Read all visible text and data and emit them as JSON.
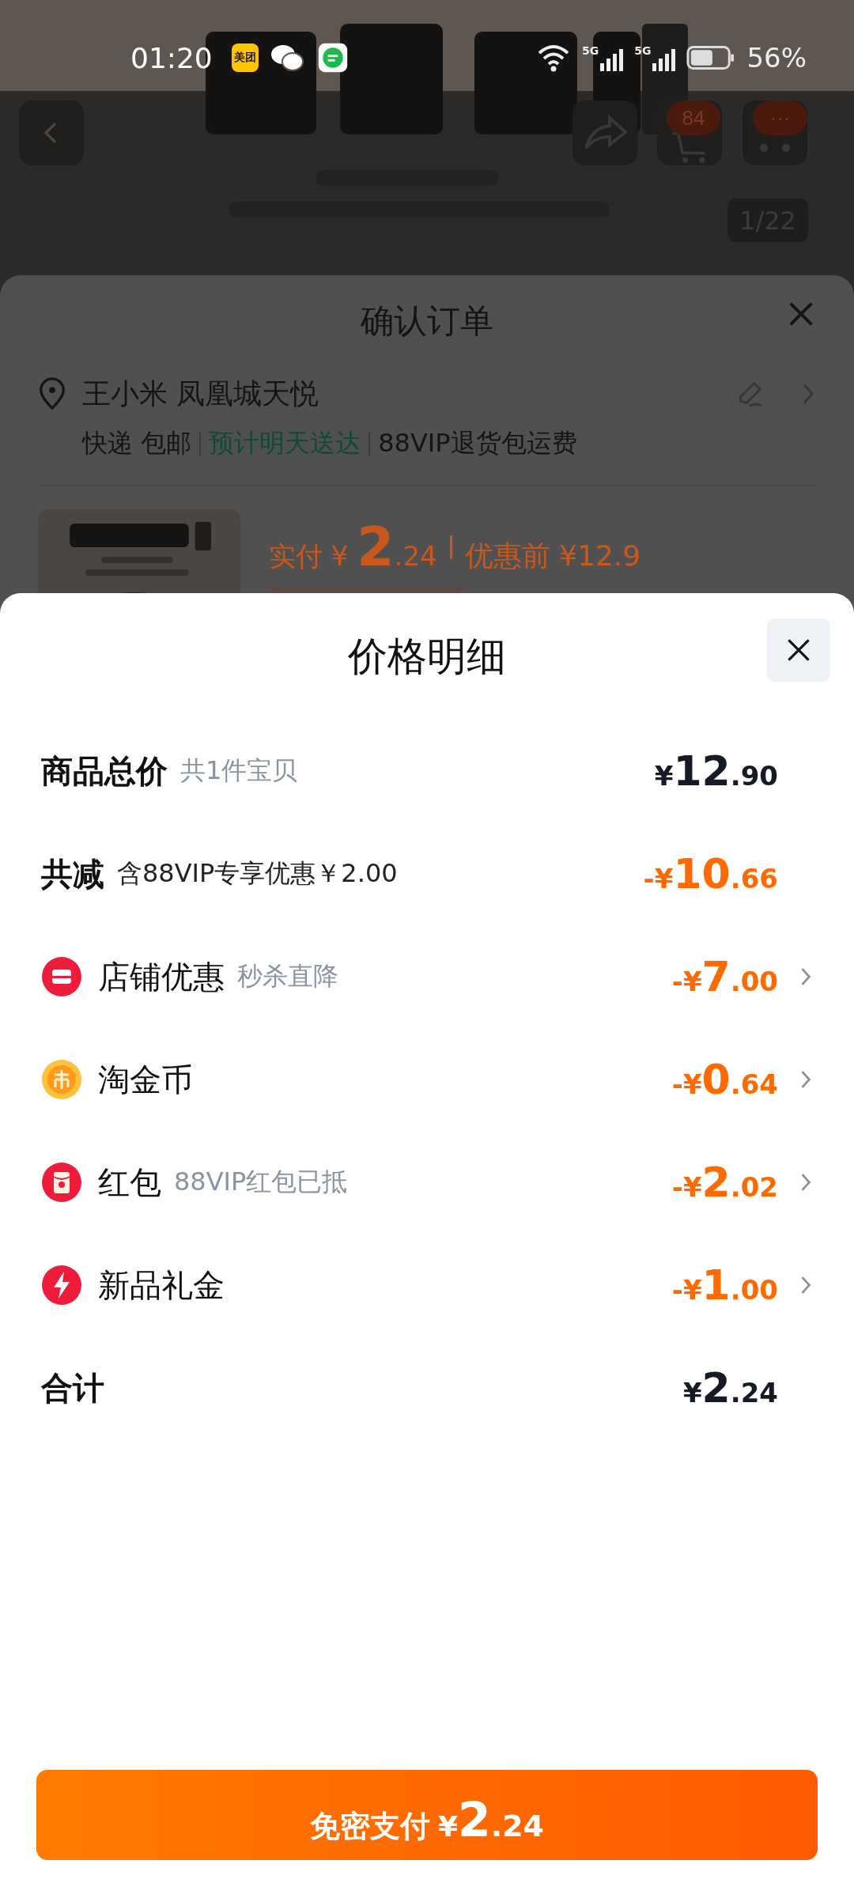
{
  "status_bar": {
    "time": "01:20",
    "app_badge": "美团",
    "network_1": "5G",
    "network_2": "5G",
    "battery": "56%"
  },
  "product_page": {
    "cart_count": "84",
    "more_badge": "···",
    "page_indicator": "1/22"
  },
  "order_sheet": {
    "title": "确认订单",
    "address": "王小米 凤凰城天悦",
    "delivery": [
      "快递 包邮",
      "预计明天送达",
      "88VIP退货包运费"
    ],
    "paid_label": "实付",
    "paid_currency": "¥",
    "paid_amount": "2.24",
    "before_label": "优惠前 ¥12.9"
  },
  "price_sheet": {
    "title": "价格明细",
    "rows": [
      {
        "kind": "subtotal",
        "label": "商品总价",
        "note": "共1件宝贝",
        "amount": "¥12.90"
      },
      {
        "kind": "reduction",
        "label": "共减",
        "note": "含88VIP专享优惠￥2.00",
        "amount": "-¥10.66"
      },
      {
        "kind": "shop",
        "label": "店铺优惠",
        "note": "秒杀直降",
        "amount": "-¥7.00"
      },
      {
        "kind": "coin",
        "label": "淘金币",
        "amount": "-¥0.64"
      },
      {
        "kind": "packet",
        "label": "红包",
        "note": "88VIP红包已抵",
        "amount": "-¥2.02"
      },
      {
        "kind": "gift",
        "label": "新品礼金",
        "amount": "-¥1.00"
      },
      {
        "kind": "total",
        "label": "合计",
        "amount": "¥2.24"
      }
    ]
  },
  "pay_button": {
    "label": "免密支付",
    "amount": "¥2.24"
  }
}
